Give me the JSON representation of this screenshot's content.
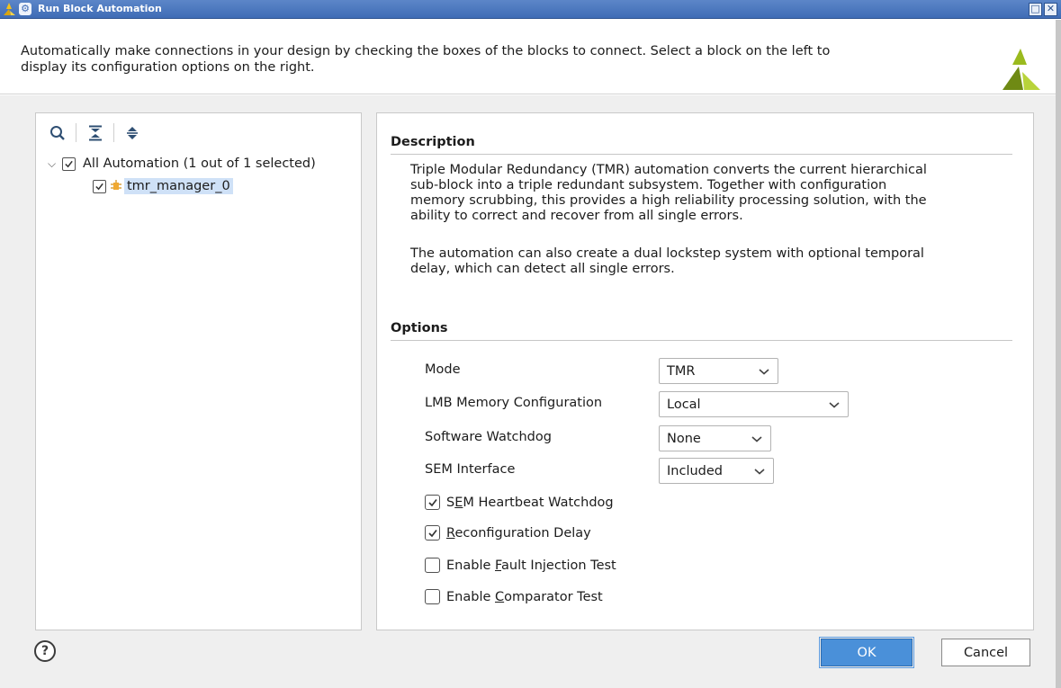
{
  "window": {
    "title": "Run Block Automation",
    "icons": [
      "xilinx-logo-icon",
      "gear-icon",
      "restore-icon",
      "close-icon"
    ],
    "maximize_glyph": "□",
    "close_glyph": "✕"
  },
  "header": {
    "intro_line1": "Automatically make connections in your design by checking the boxes of the blocks to connect. Select a block on the left to",
    "intro_line2": "display its configuration options on the right."
  },
  "tree": {
    "root_label": "All Automation (1 out of 1 selected)",
    "root_checked": true,
    "child_label": "tmr_manager_0",
    "child_checked": true,
    "toolbar_icons": [
      "search-icon",
      "collapse-all-icon",
      "expand-all-icon"
    ]
  },
  "description": {
    "title": "Description",
    "para1": [
      "Triple Modular Redundancy (TMR) automation converts the current hierarchical",
      "sub-block into a triple redundant subsystem. Together with configuration",
      "memory scrubbing, this provides a high reliability processing solution, with the",
      "ability to correct and recover from all single errors."
    ],
    "para2": [
      "The automation can also create a dual lockstep system with optional temporal",
      "delay, which can detect all single errors."
    ]
  },
  "options": {
    "title": "Options",
    "mode_label": "Mode",
    "mode_value": "TMR",
    "lmb_label": "LMB Memory Configuration",
    "lmb_value": "Local",
    "watchdog_label": "Software Watchdog",
    "watchdog_value": "None",
    "sem_label": "SEM Interface",
    "sem_value": "Included",
    "checks": [
      {
        "pre": "S",
        "ul": "E",
        "post": "M Heartbeat Watchdog",
        "checked": true
      },
      {
        "pre": "",
        "ul": "R",
        "post": "econfiguration Delay",
        "checked": true
      },
      {
        "pre": "Enable ",
        "ul": "F",
        "post": "ault Injection Test",
        "checked": false
      },
      {
        "pre": "Enable ",
        "ul": "C",
        "post": "omparator Test",
        "checked": false
      }
    ]
  },
  "footer": {
    "help_glyph": "?",
    "ok_label": "OK",
    "cancel_label": "Cancel"
  },
  "colors": {
    "titlebar": "#4a76c0",
    "accent_button": "#4a90d9",
    "selection": "#cfe1f7",
    "logo_green": "#9aba1e",
    "logo_dark": "#5a6e12"
  }
}
